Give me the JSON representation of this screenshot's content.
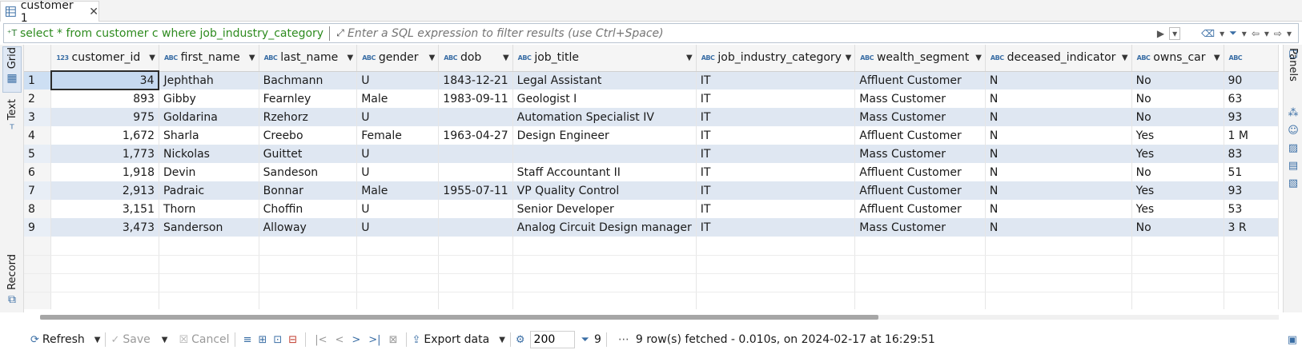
{
  "tab": {
    "label": "customer 1",
    "close_glyph": "✕"
  },
  "filter": {
    "prefix_icon": "sql-icon",
    "sql": "select * from customer c where job_industry_category = 'I",
    "placeholder": "Enter a SQL expression to filter results (use Ctrl+Space)"
  },
  "left_tabs": {
    "grid": "Grid",
    "text": "Text",
    "record": "Record"
  },
  "right_panel": {
    "label": "Panels"
  },
  "grid": {
    "columns": [
      {
        "type": "123",
        "name": "customer_id"
      },
      {
        "type": "ABC",
        "name": "first_name"
      },
      {
        "type": "ABC",
        "name": "last_name"
      },
      {
        "type": "ABC",
        "name": "gender"
      },
      {
        "type": "ABC",
        "name": "dob"
      },
      {
        "type": "ABC",
        "name": "job_title"
      },
      {
        "type": "ABC",
        "name": "job_industry_category"
      },
      {
        "type": "ABC",
        "name": "wealth_segment"
      },
      {
        "type": "ABC",
        "name": "deceased_indicator"
      },
      {
        "type": "ABC",
        "name": "owns_car"
      },
      {
        "type": "ABC",
        "name": ""
      }
    ],
    "rows": [
      {
        "num": "1",
        "cells": [
          "34",
          "Jephthah",
          "Bachmann",
          "U",
          "1843-12-21",
          "Legal Assistant",
          "IT",
          "Affluent Customer",
          "N",
          "No",
          "90"
        ]
      },
      {
        "num": "2",
        "cells": [
          "893",
          "Gibby",
          "Fearnley",
          "Male",
          "1983-09-11",
          "Geologist I",
          "IT",
          "Mass Customer",
          "N",
          "No",
          "63"
        ]
      },
      {
        "num": "3",
        "cells": [
          "975",
          "Goldarina",
          "Rzehorz",
          "U",
          "",
          "Automation Specialist IV",
          "IT",
          "Mass Customer",
          "N",
          "No",
          "93"
        ]
      },
      {
        "num": "4",
        "cells": [
          "1,672",
          "Sharla",
          "Creebo",
          "Female",
          "1963-04-27",
          "Design Engineer",
          "IT",
          "Affluent Customer",
          "N",
          "Yes",
          "1 M"
        ]
      },
      {
        "num": "5",
        "cells": [
          "1,773",
          "Nickolas",
          "Guittet",
          "U",
          "",
          "",
          "IT",
          "Mass Customer",
          "N",
          "Yes",
          "83"
        ]
      },
      {
        "num": "6",
        "cells": [
          "1,918",
          "Devin",
          "Sandeson",
          "U",
          "",
          "Staff Accountant II",
          "IT",
          "Affluent Customer",
          "N",
          "No",
          "51"
        ]
      },
      {
        "num": "7",
        "cells": [
          "2,913",
          "Padraic",
          "Bonnar",
          "Male",
          "1955-07-11",
          "VP Quality Control",
          "IT",
          "Affluent Customer",
          "N",
          "Yes",
          "93"
        ]
      },
      {
        "num": "8",
        "cells": [
          "3,151",
          "Thorn",
          "Choffin",
          "U",
          "",
          "Senior Developer",
          "IT",
          "Affluent Customer",
          "N",
          "Yes",
          "53"
        ]
      },
      {
        "num": "9",
        "cells": [
          "3,473",
          "Sanderson",
          "Alloway",
          "U",
          "",
          "Analog Circuit Design manager",
          "IT",
          "Mass Customer",
          "N",
          "No",
          "3 R"
        ]
      }
    ]
  },
  "toolbar": {
    "refresh": "Refresh",
    "save": "Save",
    "cancel": "Cancel",
    "export": "Export data",
    "fetch_size": "200",
    "row_count": "9",
    "status": "9 row(s) fetched - 0.010s, on 2024-02-17 at 16:29:51"
  },
  "colors": {
    "accent": "#3a6ea5",
    "sql_green": "#2e8b1f",
    "row_stripe": "#dfe7f2"
  }
}
